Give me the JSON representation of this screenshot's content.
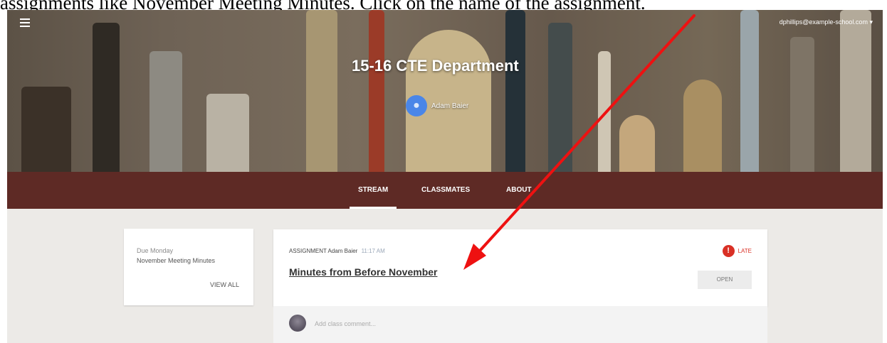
{
  "caption": "assignments like November Meeting Minutes.  Click on the name of the assignment.",
  "header": {
    "account": "dphillips@example-school.com",
    "class_title": "15-16 CTE Department",
    "teacher_name": "Adam Baier"
  },
  "tabs": [
    {
      "label": "STREAM"
    },
    {
      "label": "CLASSMATES"
    },
    {
      "label": "ABOUT"
    }
  ],
  "upcoming": {
    "due_label": "Due Monday",
    "item": "November Meeting Minutes",
    "view_all": "VIEW ALL"
  },
  "post": {
    "type": "ASSIGNMENT",
    "author": "Adam Baier",
    "time": "11:17 AM",
    "title": "Minutes from Before November",
    "status": "LATE",
    "open_label": "OPEN"
  },
  "comment": {
    "placeholder": "Add class comment..."
  },
  "colors": {
    "tab_bar": "#5e2a25",
    "late": "#d93025",
    "arrow": "#ee1111"
  },
  "icons": {
    "menu": "hamburger-icon",
    "late": "alert-icon",
    "account_dropdown": "caret-down-icon"
  }
}
